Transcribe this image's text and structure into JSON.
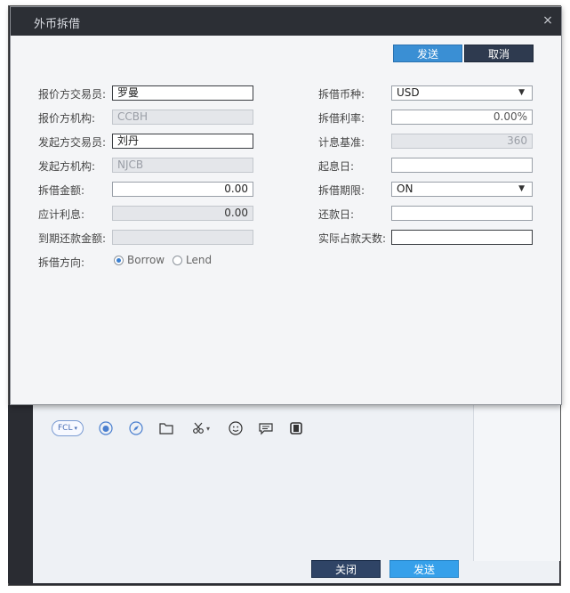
{
  "dialog": {
    "title": "外币拆借",
    "close_glyph": "×",
    "send_label": "发送",
    "cancel_label": "取消"
  },
  "left_form": {
    "quoter_trader_label": "报价方交易员:",
    "quoter_trader_value": "罗曼",
    "quoter_org_label": "报价方机构:",
    "quoter_org_value": "CCBH",
    "initiator_trader_label": "发起方交易员:",
    "initiator_trader_value": "刘丹",
    "initiator_org_label": "发起方机构:",
    "initiator_org_value": "NJCB",
    "amount_label": "拆借金额:",
    "amount_value": "0.00",
    "interest_label": "应计利息:",
    "interest_value": "0.00",
    "maturity_amount_label": "到期还款金额:",
    "maturity_amount_value": "",
    "direction_label": "拆借方向:",
    "direction_options": [
      "Borrow",
      "Lend"
    ],
    "direction_selected": "Borrow"
  },
  "right_form": {
    "currency_label": "拆借币种:",
    "currency_value": "USD",
    "rate_label": "拆借利率:",
    "rate_value": "0.00%",
    "basis_label": "计息基准:",
    "basis_value": "360",
    "start_date_label": "起息日:",
    "start_date_value": "",
    "term_label": "拆借期限:",
    "term_value": "ON",
    "repay_date_label": "还款日:",
    "repay_date_value": "",
    "actual_days_label": "实际占款天数:",
    "actual_days_value": ""
  },
  "chat_window": {
    "fcl_label": "FCL",
    "close_label": "关闭",
    "send_label": "发送",
    "toolbar_icons": [
      "fcl-pill",
      "weibo-icon",
      "compass-icon",
      "folder-icon",
      "scissors-icon",
      "smiley-icon",
      "chat-bubble-icon",
      "window-icon"
    ]
  },
  "colors": {
    "title_bar": "#2c2f35",
    "primary_button": "#3a8fd4",
    "secondary_button": "#2e3a4f",
    "radio_selected": "#3a7fd0"
  }
}
